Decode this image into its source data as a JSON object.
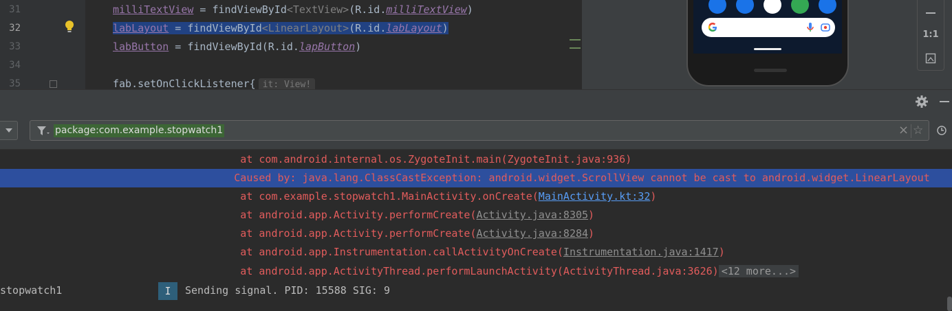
{
  "editor": {
    "line_numbers": [
      "31",
      "32",
      "33",
      "34",
      "35"
    ],
    "lines": [
      {
        "var": "milliTextView",
        "mid": " = findViewById",
        "gen": "<TextView>",
        "pre": "(R.id.",
        "id": "milliTextView",
        "end": ")"
      },
      {
        "var": "labLayout",
        "mid": " = findViewById",
        "gen": "<LinearLayout>",
        "pre": "(R.id.",
        "id": "labLayout",
        "end": ")"
      },
      {
        "var": "labButton",
        "mid": " = findViewById",
        "gen": "",
        "pre": "(R.id.",
        "id": "lapButton",
        "end": ")"
      },
      {
        "text": ""
      },
      {
        "text": "fab.setOnClickListener{",
        "hint": "it: View!"
      }
    ]
  },
  "preview": {
    "toolbar": [
      "1:1"
    ]
  },
  "filter": {
    "query": "package:com.example.stopwatch1"
  },
  "log": {
    "lines": [
      {
        "prefix": "          at com.android.internal.os.ZygoteInit.main(ZygoteInit.java:936)"
      },
      {
        "prefix": "         Caused by: java.lang.ClassCastException: android.widget.ScrollView cannot be cast to android.widget.LinearLayout"
      },
      {
        "prefix": "          at com.example.stopwatch1.MainActivity.onCreate(",
        "link": "MainActivity.kt:32",
        "suffix": ")"
      },
      {
        "prefix": "          at android.app.Activity.performCreate(",
        "src": "Activity.java:8305",
        "suffix": ")"
      },
      {
        "prefix": "          at android.app.Activity.performCreate(",
        "src": "Activity.java:8284",
        "suffix": ")"
      },
      {
        "prefix": "          at android.app.Instrumentation.callActivityOnCreate(",
        "src": "Instrumentation.java:1417",
        "suffix": ")"
      },
      {
        "prefix": "          at android.app.ActivityThread.performLaunchActivity(ActivityThread.java:3626)",
        "more": "<12 more...>"
      }
    ],
    "tag": "stopwatch1",
    "level": "I",
    "message": "Sending signal. PID: 15588 SIG: 9"
  },
  "colors": {
    "error_text": "#e25c5c",
    "selection": "#2d4f9e",
    "filter_match": "#3c6635",
    "link": "#589df6"
  }
}
